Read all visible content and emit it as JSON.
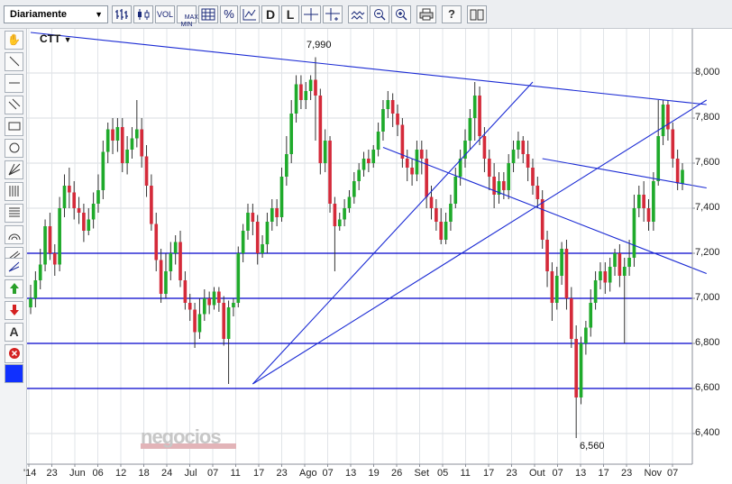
{
  "toolbar": {
    "period": "Diariamente",
    "vol_label": "VOL",
    "maxmin_label": "MAX\nMIN",
    "percent_label": "%",
    "d_label": "D",
    "l_label": "L"
  },
  "chart_data": {
    "type": "candlestick",
    "symbol": "CTT",
    "yticks": [
      "6,400",
      "6,600",
      "6,800",
      "7,000",
      "7,200",
      "7,400",
      "7,600",
      "7,800",
      "8,000"
    ],
    "ylim": [
      6.35,
      8.2
    ],
    "xticks": [
      "'14",
      "23",
      "Jun",
      "06",
      "12",
      "18",
      "24",
      "Jul",
      "07",
      "11",
      "17",
      "23",
      "Ago",
      "07",
      "13",
      "19",
      "26",
      "Set",
      "05",
      "11",
      "17",
      "23",
      "Out",
      "07",
      "13",
      "17",
      "23",
      "Nov",
      "07"
    ],
    "annotations": [
      {
        "text": "7,990",
        "value": 7.99
      },
      {
        "text": "6,560",
        "value": 6.56
      }
    ],
    "horizontal_levels": [
      7.2,
      7.0,
      6.8,
      6.6
    ],
    "trendlines": [
      {
        "from": [
          0,
          8.18
        ],
        "to": [
          140,
          7.86
        ]
      },
      {
        "from": [
          106,
          7.62
        ],
        "to": [
          140,
          7.49
        ]
      },
      {
        "from": [
          73,
          7.67
        ],
        "to": [
          140,
          7.11
        ]
      },
      {
        "from": [
          46,
          6.62
        ],
        "to": [
          140,
          7.88
        ]
      },
      {
        "from": [
          46,
          6.62
        ],
        "to": [
          104,
          7.96
        ]
      }
    ],
    "candles": [
      [
        6.96,
        7.0,
        6.93,
        7.06
      ],
      [
        7.0,
        7.08,
        6.96,
        7.12
      ],
      [
        7.08,
        7.15,
        7.04,
        7.22
      ],
      [
        7.15,
        7.32,
        7.12,
        7.35
      ],
      [
        7.32,
        7.2,
        7.17,
        7.38
      ],
      [
        7.2,
        7.15,
        7.1,
        7.24
      ],
      [
        7.15,
        7.4,
        7.12,
        7.45
      ],
      [
        7.4,
        7.5,
        7.36,
        7.55
      ],
      [
        7.5,
        7.47,
        7.4,
        7.58
      ],
      [
        7.47,
        7.4,
        7.35,
        7.52
      ],
      [
        7.4,
        7.38,
        7.33,
        7.45
      ],
      [
        7.38,
        7.3,
        7.25,
        7.42
      ],
      [
        7.3,
        7.35,
        7.28,
        7.4
      ],
      [
        7.35,
        7.42,
        7.31,
        7.47
      ],
      [
        7.42,
        7.48,
        7.38,
        7.55
      ],
      [
        7.48,
        7.65,
        7.44,
        7.7
      ],
      [
        7.65,
        7.75,
        7.6,
        7.78
      ],
      [
        7.75,
        7.7,
        7.64,
        7.8
      ],
      [
        7.7,
        7.76,
        7.65,
        7.8
      ],
      [
        7.76,
        7.6,
        7.56,
        7.8
      ],
      [
        7.6,
        7.66,
        7.55,
        7.72
      ],
      [
        7.66,
        7.71,
        7.62,
        7.76
      ],
      [
        7.71,
        7.75,
        7.67,
        7.88
      ],
      [
        7.75,
        7.63,
        7.58,
        7.8
      ],
      [
        7.63,
        7.5,
        7.45,
        7.68
      ],
      [
        7.5,
        7.33,
        7.3,
        7.55
      ],
      [
        7.33,
        7.17,
        7.12,
        7.38
      ],
      [
        7.17,
        7.02,
        6.98,
        7.22
      ],
      [
        7.02,
        7.12,
        7.0,
        7.2
      ],
      [
        7.12,
        7.2,
        7.08,
        7.25
      ],
      [
        7.2,
        7.25,
        7.15,
        7.28
      ],
      [
        7.25,
        7.08,
        7.05,
        7.3
      ],
      [
        7.08,
        6.98,
        6.95,
        7.12
      ],
      [
        6.98,
        6.95,
        6.9,
        7.02
      ],
      [
        6.95,
        6.85,
        6.78,
        6.98
      ],
      [
        6.85,
        6.93,
        6.82,
        7.0
      ],
      [
        6.93,
        7.0,
        6.9,
        7.04
      ],
      [
        7.0,
        6.97,
        6.93,
        7.03
      ],
      [
        6.97,
        7.03,
        6.95,
        7.05
      ],
      [
        7.03,
        6.98,
        6.94,
        7.05
      ],
      [
        6.98,
        6.82,
        6.79,
        7.01
      ],
      [
        6.82,
        6.96,
        6.62,
        6.99
      ],
      [
        6.96,
        6.98,
        6.92,
        7.0
      ],
      [
        6.98,
        7.2,
        6.96,
        7.23
      ],
      [
        7.2,
        7.3,
        7.16,
        7.33
      ],
      [
        7.3,
        7.38,
        7.26,
        7.42
      ],
      [
        7.38,
        7.34,
        7.28,
        7.42
      ],
      [
        7.34,
        7.2,
        7.15,
        7.37
      ],
      [
        7.2,
        7.24,
        7.18,
        7.28
      ],
      [
        7.24,
        7.34,
        7.2,
        7.38
      ],
      [
        7.34,
        7.4,
        7.3,
        7.44
      ],
      [
        7.4,
        7.36,
        7.32,
        7.44
      ],
      [
        7.36,
        7.54,
        7.34,
        7.58
      ],
      [
        7.54,
        7.64,
        7.5,
        7.72
      ],
      [
        7.64,
        7.82,
        7.6,
        7.88
      ],
      [
        7.82,
        7.95,
        7.78,
        7.99
      ],
      [
        7.95,
        7.88,
        7.84,
        7.99
      ],
      [
        7.88,
        7.92,
        7.84,
        7.96
      ],
      [
        7.92,
        7.97,
        7.88,
        7.99
      ],
      [
        7.97,
        7.9,
        7.7,
        8.07
      ],
      [
        7.9,
        7.6,
        7.55,
        7.93
      ],
      [
        7.6,
        7.7,
        7.56,
        7.75
      ],
      [
        7.7,
        7.42,
        7.38,
        7.72
      ],
      [
        7.42,
        7.32,
        7.12,
        7.45
      ],
      [
        7.32,
        7.35,
        7.3,
        7.38
      ],
      [
        7.35,
        7.4,
        7.32,
        7.44
      ],
      [
        7.4,
        7.45,
        7.38,
        7.48
      ],
      [
        7.45,
        7.52,
        7.42,
        7.56
      ],
      [
        7.52,
        7.57,
        7.48,
        7.6
      ],
      [
        7.57,
        7.62,
        7.54,
        7.65
      ],
      [
        7.62,
        7.6,
        7.56,
        7.66
      ],
      [
        7.6,
        7.66,
        7.58,
        7.68
      ],
      [
        7.66,
        7.74,
        7.63,
        7.78
      ],
      [
        7.74,
        7.84,
        7.7,
        7.88
      ],
      [
        7.84,
        7.88,
        7.8,
        7.92
      ],
      [
        7.88,
        7.82,
        7.76,
        7.91
      ],
      [
        7.82,
        7.77,
        7.72,
        7.86
      ],
      [
        7.77,
        7.62,
        7.58,
        7.8
      ],
      [
        7.62,
        7.58,
        7.52,
        7.66
      ],
      [
        7.58,
        7.55,
        7.5,
        7.62
      ],
      [
        7.55,
        7.66,
        7.52,
        7.7
      ],
      [
        7.66,
        7.62,
        7.55,
        7.7
      ],
      [
        7.62,
        7.45,
        7.4,
        7.66
      ],
      [
        7.45,
        7.4,
        7.35,
        7.5
      ],
      [
        7.4,
        7.34,
        7.3,
        7.44
      ],
      [
        7.34,
        7.26,
        7.24,
        7.4
      ],
      [
        7.26,
        7.34,
        7.24,
        7.38
      ],
      [
        7.34,
        7.42,
        7.3,
        7.46
      ],
      [
        7.42,
        7.54,
        7.4,
        7.58
      ],
      [
        7.54,
        7.62,
        7.5,
        7.66
      ],
      [
        7.62,
        7.7,
        7.58,
        7.75
      ],
      [
        7.7,
        7.8,
        7.66,
        7.84
      ],
      [
        7.8,
        7.9,
        7.7,
        7.96
      ],
      [
        7.9,
        7.72,
        7.68,
        7.94
      ],
      [
        7.72,
        7.62,
        7.56,
        7.76
      ],
      [
        7.62,
        7.54,
        7.48,
        7.66
      ],
      [
        7.54,
        7.46,
        7.4,
        7.6
      ],
      [
        7.46,
        7.52,
        7.42,
        7.56
      ],
      [
        7.52,
        7.48,
        7.44,
        7.56
      ],
      [
        7.48,
        7.6,
        7.44,
        7.64
      ],
      [
        7.6,
        7.66,
        7.56,
        7.7
      ],
      [
        7.66,
        7.7,
        7.62,
        7.74
      ],
      [
        7.7,
        7.64,
        7.6,
        7.72
      ],
      [
        7.64,
        7.58,
        7.52,
        7.7
      ],
      [
        7.58,
        7.5,
        7.46,
        7.62
      ],
      [
        7.5,
        7.44,
        7.4,
        7.54
      ],
      [
        7.44,
        7.26,
        7.22,
        7.48
      ],
      [
        7.26,
        7.12,
        7.05,
        7.3
      ],
      [
        7.12,
        6.98,
        6.9,
        7.16
      ],
      [
        6.98,
        7.1,
        6.95,
        7.14
      ],
      [
        7.1,
        7.22,
        7.06,
        7.25
      ],
      [
        7.22,
        7.0,
        6.95,
        7.26
      ],
      [
        7.0,
        6.82,
        6.78,
        7.05
      ],
      [
        6.82,
        6.56,
        6.38,
        6.88
      ],
      [
        6.56,
        6.8,
        6.53,
        6.83
      ],
      [
        6.8,
        6.87,
        6.75,
        6.9
      ],
      [
        6.87,
        6.98,
        6.83,
        7.04
      ],
      [
        6.98,
        7.08,
        6.95,
        7.12
      ],
      [
        7.08,
        7.12,
        7.04,
        7.16
      ],
      [
        7.12,
        7.07,
        7.02,
        7.16
      ],
      [
        7.07,
        7.14,
        7.03,
        7.18
      ],
      [
        7.14,
        7.2,
        7.1,
        7.22
      ],
      [
        7.2,
        7.1,
        7.05,
        7.24
      ],
      [
        7.1,
        7.14,
        6.8,
        7.18
      ],
      [
        7.14,
        7.18,
        7.1,
        7.26
      ],
      [
        7.18,
        7.4,
        7.14,
        7.46
      ],
      [
        7.4,
        7.46,
        7.36,
        7.5
      ],
      [
        7.46,
        7.4,
        7.34,
        7.52
      ],
      [
        7.4,
        7.34,
        7.3,
        7.44
      ],
      [
        7.34,
        7.52,
        7.3,
        7.56
      ],
      [
        7.52,
        7.72,
        7.5,
        7.88
      ],
      [
        7.72,
        7.86,
        7.68,
        7.88
      ],
      [
        7.86,
        7.75,
        7.7,
        7.88
      ],
      [
        7.75,
        7.62,
        7.58,
        7.78
      ],
      [
        7.62,
        7.51,
        7.48,
        7.66
      ],
      [
        7.51,
        7.57,
        7.48,
        7.6
      ]
    ]
  },
  "watermark": "negocios"
}
